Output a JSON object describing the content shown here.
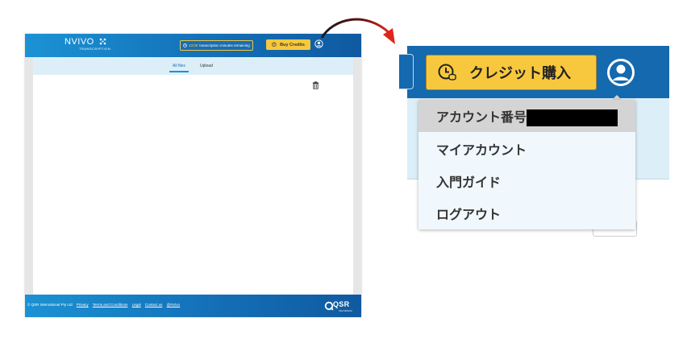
{
  "mini_app": {
    "brand": {
      "name": "NVIVO",
      "sub": "TRANSCRIPTION"
    },
    "credits": {
      "time": "13:00",
      "text": "transcription minutes remaining"
    },
    "buy_label": "Buy Credits",
    "tabs": [
      {
        "label": "All files"
      },
      {
        "label": "Upload"
      }
    ],
    "footer": {
      "copyright": "© QSR International Pty Ltd",
      "links": [
        "Privacy",
        "Terms and Conditions",
        "Legal",
        "Contact us",
        "@NVivo"
      ]
    },
    "footer_logo": {
      "name": "QSR",
      "sub": "International"
    }
  },
  "zoom": {
    "buy_label": "クレジット購入",
    "menu": {
      "items": [
        {
          "label": "アカウント番号"
        },
        {
          "label": "マイアカウント"
        },
        {
          "label": "入門ガイド"
        },
        {
          "label": "ログアウト"
        }
      ]
    }
  },
  "colors": {
    "header_blue": "#1469af",
    "buy_yellow": "#f7c83d",
    "arrow_red": "#e0261b",
    "menu_bg": "#f1f8fd",
    "menu_hover": "#d4d4d4"
  }
}
